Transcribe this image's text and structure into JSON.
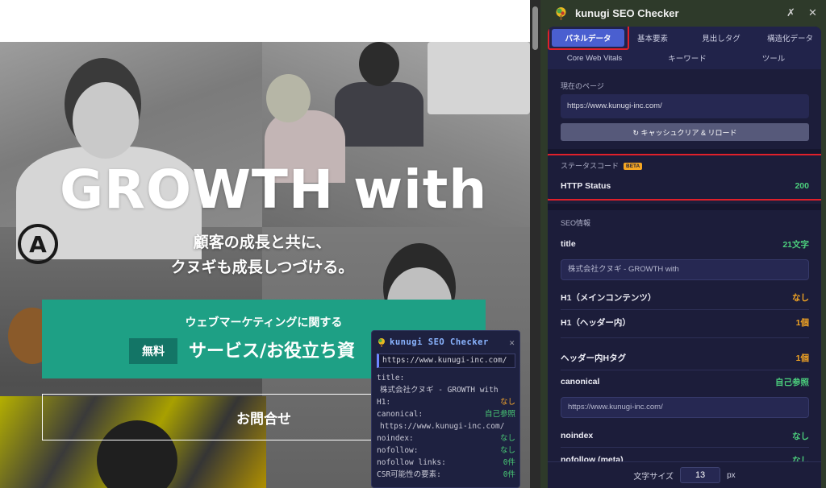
{
  "website": {
    "hero_title": "GROWTH with",
    "hero_sub_line1": "顧客の成長と共に、",
    "hero_sub_line2": "クヌギも成長しつづける。",
    "cta_line1": "ウェブマーケティングに関する",
    "cta_badge": "無料",
    "cta_line2": "サービス/お役立ち資",
    "contact_button": "お問合せ",
    "logo_letter": "A"
  },
  "mini_popup": {
    "title": "kunugi SEO Checker",
    "url": "https://www.kunugi-inc.com/",
    "title_label": "title:",
    "title_value": "株式会社クヌギ - GROWTH with",
    "h1_label": "H1:",
    "h1_value": "なし",
    "canonical_label": "canonical:",
    "canonical_value": "自己参照",
    "canonical_url": "https://www.kunugi-inc.com/",
    "noindex_label": "noindex:",
    "noindex_value": "なし",
    "nofollow_label": "nofollow:",
    "nofollow_value": "なし",
    "nofollow_links_label": "nofollow links:",
    "nofollow_links_value": "0件",
    "csr_label": "CSR可能性の要素:",
    "csr_value": "0件"
  },
  "extension": {
    "title": "kunugi SEO Checker",
    "tabs": [
      {
        "label": "パネルデータ"
      },
      {
        "label": "基本要素"
      },
      {
        "label": "見出しタグ"
      },
      {
        "label": "構造化データ"
      },
      {
        "label": "Core Web Vitals"
      },
      {
        "label": "キーワード"
      },
      {
        "label": "ツール"
      }
    ],
    "current_page": {
      "label": "現在のページ",
      "url": "https://www.kunugi-inc.com/",
      "reload_button": "↻ キャッシュクリア & リロード"
    },
    "status": {
      "label": "ステータスコード",
      "beta": "BETA",
      "http_label": "HTTP Status",
      "http_value": "200"
    },
    "seo": {
      "label": "SEO情報",
      "title_label": "title",
      "title_count": "21文字",
      "title_value": "株式会社クヌギ - GROWTH with",
      "h1_main_label": "H1（メインコンテンツ）",
      "h1_main_value": "なし",
      "h1_header_label": "H1（ヘッダー内）",
      "h1_header_value": "1個",
      "header_h_label": "ヘッダー内Hタグ",
      "header_h_value": "1個",
      "canonical_label": "canonical",
      "canonical_value": "自己参照",
      "canonical_url": "https://www.kunugi-inc.com/",
      "noindex_label": "noindex",
      "noindex_value": "なし",
      "nofollow_meta_label": "nofollow (meta)",
      "nofollow_meta_value": "なし"
    },
    "footer": {
      "font_size_label": "文字サイズ",
      "font_size_value": "13",
      "unit": "px"
    }
  },
  "colors": {
    "accent_blue": "#4a5fd0",
    "ok_green": "#4cd07d",
    "warn_orange": "#f5a623",
    "highlight_red": "#e0202a",
    "cta_green": "#1ea085"
  }
}
